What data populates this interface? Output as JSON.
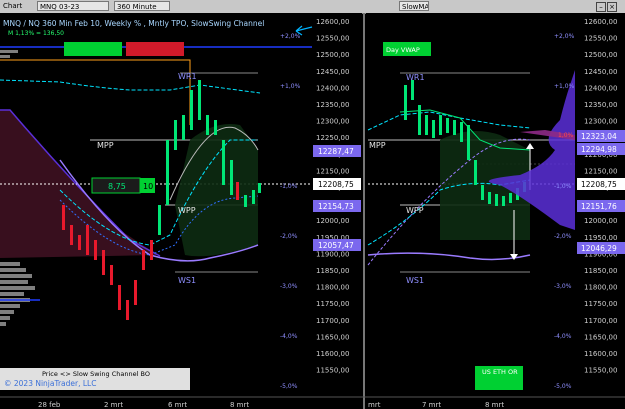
{
  "toolbar": {
    "chart_label": "Chart",
    "instrument": "MNQ 03-23",
    "interval": "360 Minute",
    "right_tab": "SlowMA"
  },
  "colors": {
    "background": "#000000",
    "grid": "#1a1a1a",
    "axis_text": "#cfcfcf",
    "bull_candle": "#00e676",
    "bear_candle": "#e8192c",
    "cyan_line": "#00e5ff",
    "purple_line": "#9a7bff",
    "tpo_profile": "#7f7f7f",
    "volume_profile": "#5a2fd8",
    "price_marker": "#7b68ee",
    "white_marker": "#ffffff",
    "green_button": "#00d032",
    "red_button": "#d11a2a",
    "orange_line": "#ff9f1a"
  },
  "left_chart": {
    "title": "MNQ / NQ 360 Min Feb 10, Weekly % , Mntly TPO, SlowSwing Channel",
    "subtitle": "M 1,13% = 136,50",
    "level_labels": {
      "wr1": "WR1",
      "mpp": "MPP",
      "wpp": "WPP",
      "ws1": "WS1"
    },
    "percent_labels": [
      "+2,0%",
      "+1,0%",
      "-1,0%",
      "-2,0%",
      "-3,0%",
      "-4,0%",
      "-5,0%"
    ],
    "position_box": {
      "left": "8,75",
      "right": "10"
    },
    "footer_label": "Price <> Slow Swing Channel BO",
    "copyright": "© 2023 NinjaTrader, LLC",
    "price_axis_ticks": [
      "12600,00",
      "12550,00",
      "12500,00",
      "12450,00",
      "12400,00",
      "12350,00",
      "12300,00",
      "12250,00",
      "12200,00",
      "12150,00",
      "12100,00",
      "12050,00",
      "12000,00",
      "11950,00",
      "11900,00",
      "11850,00",
      "11800,00",
      "11750,00",
      "11700,00",
      "11650,00",
      "11600,00",
      "11550,00"
    ],
    "price_markers": [
      {
        "label": "12287,47",
        "style": "purple"
      },
      {
        "label": "12208,75",
        "style": "white"
      },
      {
        "label": "12154,73",
        "style": "purple"
      },
      {
        "label": "12057,47",
        "style": "purple"
      }
    ],
    "time_axis": [
      "28 feb",
      "2 mrt",
      "6 mrt",
      "8 mrt"
    ]
  },
  "right_chart": {
    "top_button": "Day VWAP",
    "bottom_button": "US ETH OR",
    "level_labels": {
      "wr1": "WR1",
      "mpp": "MPP",
      "wpp": "WPP",
      "ws1": "WS1"
    },
    "percent_labels": [
      "+2,0%",
      "+1,0%",
      "-1,0%",
      "-2,0%",
      "-3,0%",
      "-4,0%",
      "-5,0%"
    ],
    "red_level": "1,0%",
    "price_axis_ticks": [
      "12600,00",
      "12550,00",
      "12500,00",
      "12450,00",
      "12400,00",
      "12350,00",
      "12300,00",
      "12250,00",
      "12200,00",
      "12150,00",
      "12100,00",
      "12050,00",
      "12000,00",
      "11950,00",
      "11900,00",
      "11850,00",
      "11800,00",
      "11750,00",
      "11700,00",
      "11650,00",
      "11600,00",
      "11550,00"
    ],
    "price_markers": [
      {
        "label": "12323,04",
        "style": "purple"
      },
      {
        "label": "12294,98",
        "style": "purple"
      },
      {
        "label": "12208,75",
        "style": "white"
      },
      {
        "label": "12151,76",
        "style": "purple"
      },
      {
        "label": "12046,29",
        "style": "purple"
      }
    ],
    "time_axis": [
      "mrt",
      "7 mrt",
      "8 mrt"
    ]
  }
}
